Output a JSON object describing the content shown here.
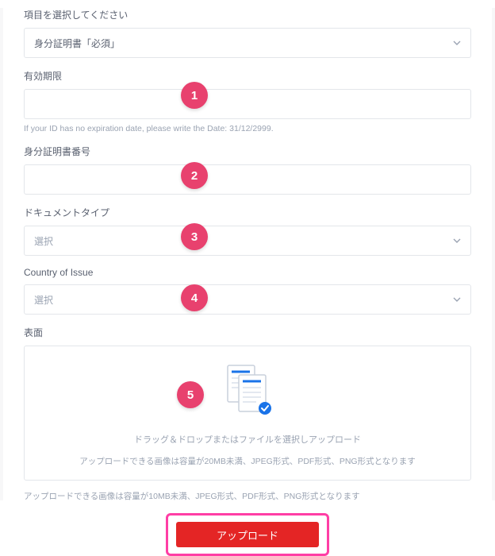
{
  "instruction": "項目を選択してください",
  "select_primary": {
    "value": "身分証明書「必須」"
  },
  "fields": {
    "expiry": {
      "label": "有効期限",
      "hint": "If your ID has no expiration date, please write the Date: 31/12/2999."
    },
    "id_number": {
      "label": "身分証明書番号"
    },
    "doc_type": {
      "label": "ドキュメントタイプ",
      "value": "選択"
    },
    "country": {
      "label": "Country of Issue",
      "value": "選択"
    },
    "surface": {
      "label": "表面"
    }
  },
  "dropzone": {
    "line1": "ドラッグ＆ドロップまたはファイルを選択しアップロード",
    "line2": "アップロードできる画像は容量が20MB未満、JPEG形式、PDF形式、PNG形式となります"
  },
  "page_hint": "アップロードできる画像は容量が10MB未満、JPEG形式、PDF形式、PNG形式となります",
  "upload_button": "アップロード",
  "annotations": {
    "1": "1",
    "2": "2",
    "3": "3",
    "4": "4",
    "5": "5"
  }
}
